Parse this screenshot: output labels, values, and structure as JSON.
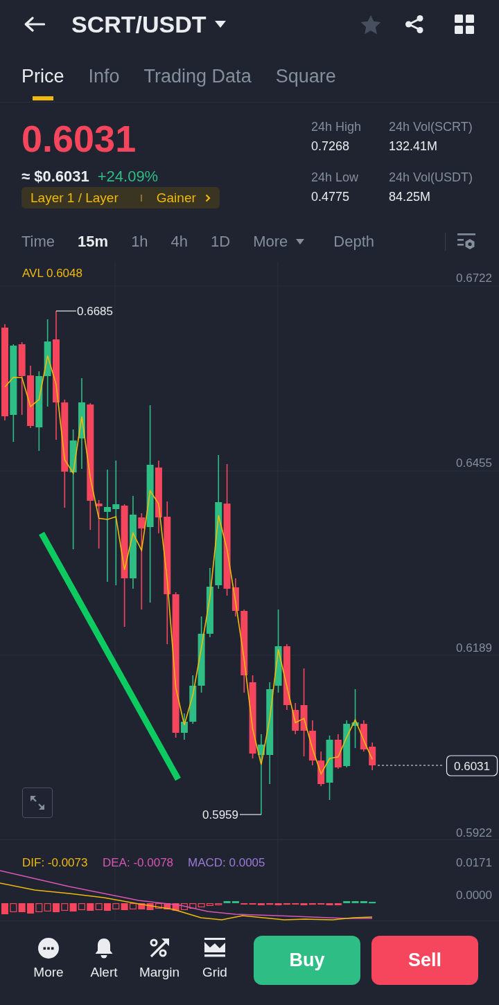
{
  "header": {
    "title": "SCRT/USDT",
    "favorited": false
  },
  "tabs": [
    {
      "label": "Price",
      "selected": true
    },
    {
      "label": "Info",
      "selected": false
    },
    {
      "label": "Trading Data",
      "selected": false
    },
    {
      "label": "Square",
      "selected": false
    }
  ],
  "ticker": {
    "price": "0.6031",
    "fiat_price": "≈ $0.6031",
    "change": "+24.09%",
    "tags": [
      "Layer 1 / Layer",
      "Gainer"
    ]
  },
  "stats": [
    {
      "label": "24h High",
      "value": "0.7268"
    },
    {
      "label": "24h Vol(SCRT)",
      "value": "132.41M"
    },
    {
      "label": "24h Low",
      "value": "0.4775"
    },
    {
      "label": "24h Vol(USDT)",
      "value": "84.25M"
    }
  ],
  "intervals": [
    {
      "label": "Time",
      "kind": "option",
      "selected": false
    },
    {
      "label": "15m",
      "kind": "option",
      "selected": true
    },
    {
      "label": "1h",
      "kind": "option",
      "selected": false
    },
    {
      "label": "4h",
      "kind": "option",
      "selected": false
    },
    {
      "label": "1D",
      "kind": "option",
      "selected": false
    },
    {
      "label": "More",
      "kind": "dropdown",
      "selected": false
    },
    {
      "label": "Depth",
      "kind": "option",
      "selected": false
    }
  ],
  "chart": {
    "average_label": "AVL 0.6048",
    "y_ticks": [
      "0.6722",
      "0.6455",
      "0.6189",
      "0.5922"
    ],
    "high_label": "0.6685",
    "low_label": "0.5959",
    "last_price": "0.6031"
  },
  "macd": {
    "indicators": [
      {
        "label": "DIF: -0.0073",
        "color": "#f0b90b"
      },
      {
        "label": "DEA: -0.0078",
        "color": "#d757b4"
      },
      {
        "label": "MACD: 0.0005",
        "color": "#9a7bd6"
      }
    ],
    "y_ticks": [
      "0.0171",
      "0.0000"
    ]
  },
  "toolbar": [
    {
      "label": "More"
    },
    {
      "label": "Alert"
    },
    {
      "label": "Margin"
    },
    {
      "label": "Grid"
    }
  ],
  "actions": [
    {
      "label": "Buy",
      "kind": "buy"
    },
    {
      "label": "Sell",
      "kind": "sell"
    }
  ]
}
